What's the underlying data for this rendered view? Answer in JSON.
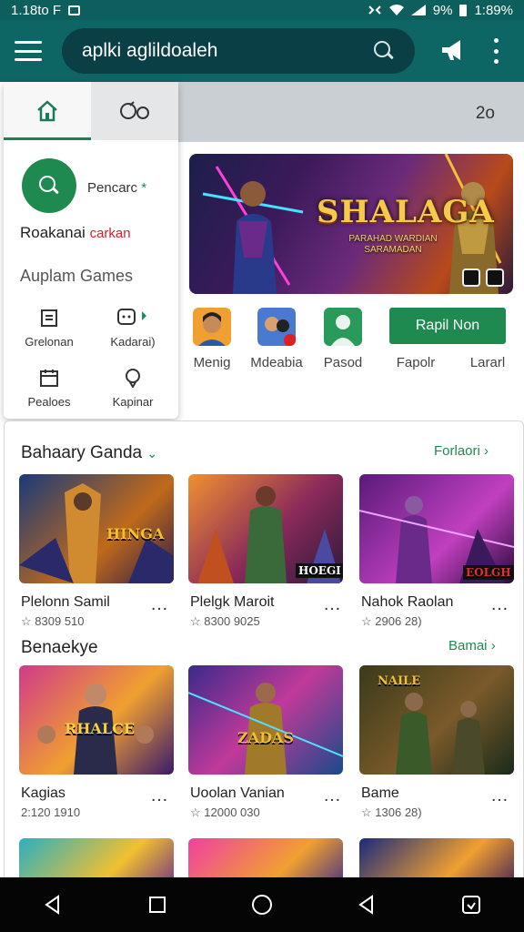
{
  "status_bar": {
    "time": "1.18to F",
    "battery": "9%",
    "clock": "1:89%"
  },
  "search": {
    "text": "aplki aglildoaleh"
  },
  "strip": {
    "count": "2o"
  },
  "panel": {
    "fab_label": "Pencarc",
    "line1_a": "Roakanai",
    "line1_b": "carkan",
    "line2": "Auplam Games",
    "grid": [
      {
        "label": "Grelonan",
        "icon": "clipboard-icon"
      },
      {
        "label": "Kadarai)",
        "icon": "chat-icon"
      },
      {
        "label": "Pealoes",
        "icon": "calendar-icon"
      },
      {
        "label": "Kapinar",
        "icon": "pin-icon"
      }
    ]
  },
  "banner": {
    "title": "SHALAGA",
    "subtitle": "PARAHAD WARDIAN SARAMADAN"
  },
  "quick_apps": [
    {
      "label": "Menig"
    },
    {
      "label": "Mdeabia"
    },
    {
      "label": "Pasod"
    },
    {
      "label": "Fapolr"
    },
    {
      "label": "Lararl"
    }
  ],
  "green_button": "Rapil Non",
  "sections": [
    {
      "title": "Bahaary Ganda",
      "link": "Forlaori",
      "games": [
        {
          "title": "Plelonn Samil",
          "meta": "8309 510",
          "badge": "HINGA"
        },
        {
          "title": "Plelgk Maroit",
          "meta": "8300 9025",
          "badge": "HOEGI"
        },
        {
          "title": "Nahok Raolan",
          "meta": "2906 28)",
          "badge": "EOLGH"
        }
      ]
    },
    {
      "title": "Benaekye",
      "link": "Bamai",
      "games": [
        {
          "title": "Kagias",
          "meta": "2:120 1910",
          "badge": "RHALCE"
        },
        {
          "title": "Uoolan Vanian",
          "meta": "12000 030",
          "badge": "ZADAS"
        },
        {
          "title": "Bame",
          "meta": "1306 28)",
          "badge": "NAILE"
        }
      ]
    }
  ],
  "colors": {
    "primary": "#0e6664",
    "accent": "#1e8a4f",
    "status": "#0d5f5e"
  }
}
